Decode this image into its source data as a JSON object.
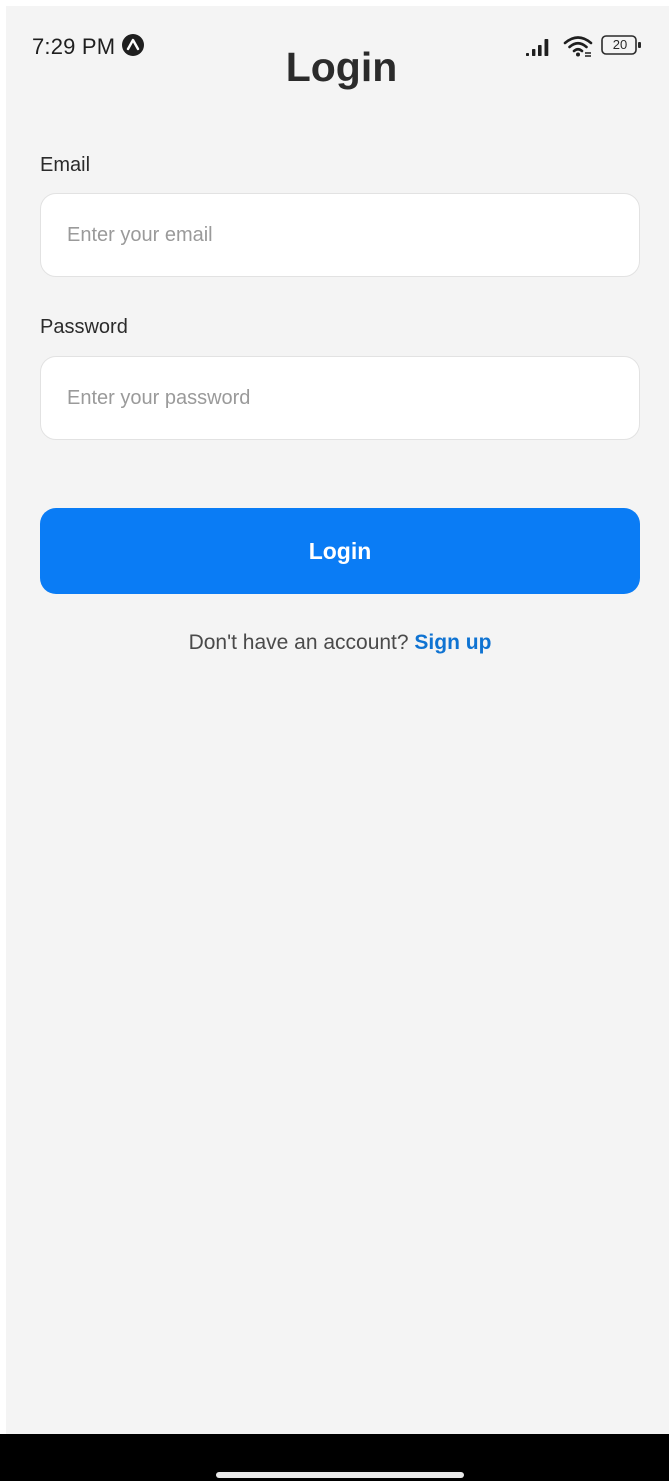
{
  "status_bar": {
    "time": "7:29 PM",
    "app_icon": "expo-icon",
    "signal_icon": "signal-icon",
    "wifi_icon": "wifi-icon",
    "battery_level": "20"
  },
  "header": {
    "title": "Login"
  },
  "form": {
    "email": {
      "label": "Email",
      "placeholder": "Enter your email",
      "value": ""
    },
    "password": {
      "label": "Password",
      "placeholder": "Enter your password",
      "value": ""
    },
    "submit_label": "Login"
  },
  "signup": {
    "prompt": "Don't have an account?",
    "link_label": "Sign up"
  },
  "colors": {
    "background": "#f4f4f4",
    "primary_button": "#0a7cf5",
    "link": "#0f73d2",
    "text": "#2b2b2b",
    "placeholder": "#9a9a9a"
  }
}
